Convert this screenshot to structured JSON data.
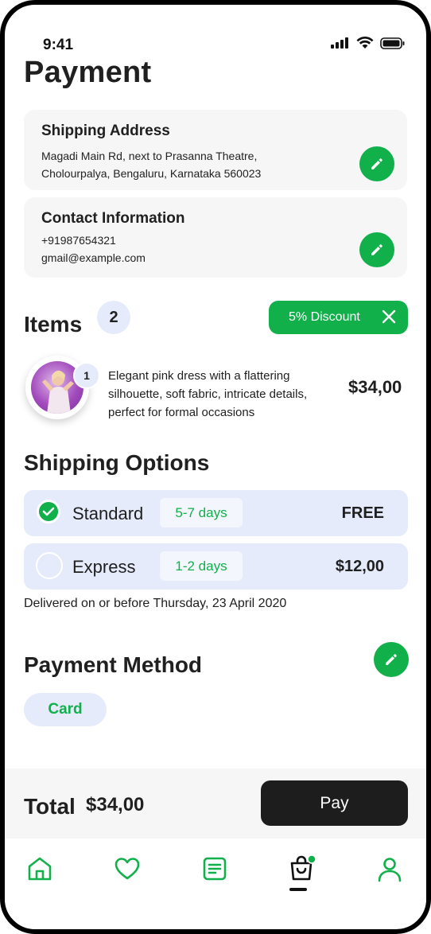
{
  "status_bar": {
    "time": "9:41"
  },
  "page": {
    "title": "Payment"
  },
  "shipping_address": {
    "title": "Shipping Address",
    "line1": "Magadi Main Rd, next to Prasanna Theatre,",
    "line2": "Cholourpalya, Bengaluru, Karnataka 560023"
  },
  "contact": {
    "title": "Contact Information",
    "phone": "+91987654321",
    "email": "gmail@example.com"
  },
  "items": {
    "title": "Items",
    "count": "2",
    "discount_label": "5% Discount",
    "list": [
      {
        "quantity": "1",
        "description": "Elegant pink dress with a flattering silhouette, soft fabric, intricate details, perfect for formal occasions",
        "price": "$34,00"
      }
    ]
  },
  "shipping_options": {
    "title": "Shipping Options",
    "options": [
      {
        "name": "Standard",
        "days": "5-7 days",
        "price": "FREE",
        "selected": true
      },
      {
        "name": "Express",
        "days": "1-2 days",
        "price": "$12,00",
        "selected": false
      }
    ],
    "delivery_note": "Delivered on or before Thursday, 23 April 2020"
  },
  "payment_method": {
    "title": "Payment Method",
    "selected": "Card"
  },
  "footer": {
    "total_label": "Total",
    "total_value": "$34,00",
    "pay_label": "Pay"
  },
  "colors": {
    "accent": "#11b04a",
    "chip_bg": "#e5ebfb",
    "card_bg": "#f6f6f6",
    "dark_button": "#1d1d1d"
  },
  "nav": {
    "items": [
      "home-icon",
      "heart-icon",
      "orders-icon",
      "cart-icon",
      "profile-icon"
    ],
    "active": "cart-icon"
  }
}
